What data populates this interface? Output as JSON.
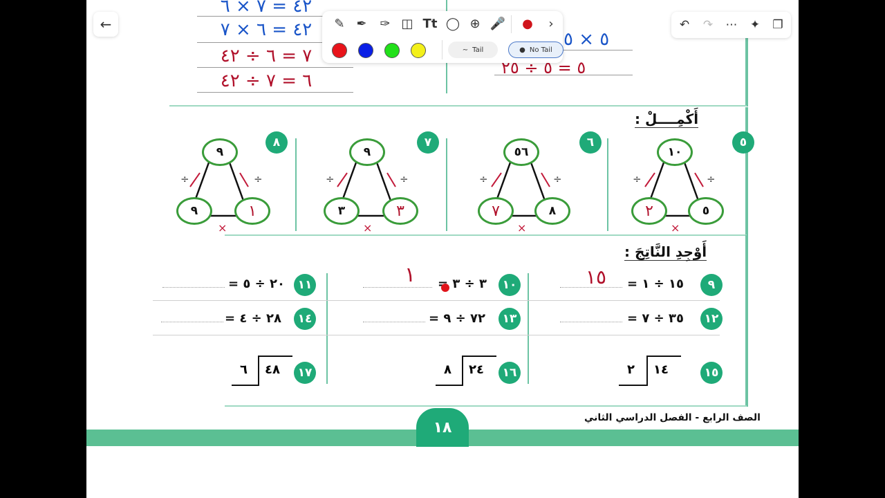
{
  "toolbar": {
    "tail_label": "Tail",
    "no_tail_label": "No Tail",
    "text_tool_label": "Tt",
    "colors": [
      "#e8141b",
      "#0a1fe6",
      "#22e01a",
      "#f3f01a"
    ]
  },
  "top_work": {
    "left_lines": [
      "٤٢ = ٧ × ٦",
      "٤٢ = ٦ × ٧",
      "٧ = ٦ ÷ ٤٢",
      "٦ = ٧ ÷ ٤٢"
    ],
    "right_lines": [
      "٥ × ٥",
      "٥ = ٥ ÷ ٢٥"
    ]
  },
  "section1": {
    "title": "أَكْمِــــلْ :",
    "triangles": [
      {
        "num": "٥",
        "top": "١٠",
        "left": "٢",
        "right": "٥"
      },
      {
        "num": "٦",
        "top": "٥٦",
        "left": "٧",
        "right": "٨"
      },
      {
        "num": "٧",
        "top": "٩",
        "left": "٣",
        "right": "٣"
      },
      {
        "num": "٨",
        "top": "٩",
        "left": "٩",
        "right": "١"
      }
    ],
    "div_sign": "÷",
    "times_sign": "×"
  },
  "section2": {
    "title": "أَوْجِدِ النَّاتِجَ :",
    "problems": [
      {
        "num": "٩",
        "expr": "١٥ ÷ ١ =",
        "answer": "١٥"
      },
      {
        "num": "١٠",
        "expr": "٣ ÷ ٣ =",
        "answer": "١"
      },
      {
        "num": "١١",
        "expr": "٢٠ ÷ ٥ =",
        "answer": ""
      },
      {
        "num": "١٢",
        "expr": "٣٥ ÷ ٧ =",
        "answer": ""
      },
      {
        "num": "١٣",
        "expr": "٧٢ ÷ ٩ =",
        "answer": ""
      },
      {
        "num": "١٤",
        "expr": "٢٨ ÷ ٤ =",
        "answer": ""
      }
    ],
    "long_division": [
      {
        "num": "١٥",
        "dividend": "١٤",
        "divisor": "٢"
      },
      {
        "num": "١٦",
        "dividend": "٢٤",
        "divisor": "٨"
      },
      {
        "num": "١٧",
        "dividend": "٤٨",
        "divisor": "٦"
      }
    ]
  },
  "footer": {
    "grade_label": "الصف الرابع - الفصل الدراسي  الثاني",
    "page_number": "١٨"
  }
}
